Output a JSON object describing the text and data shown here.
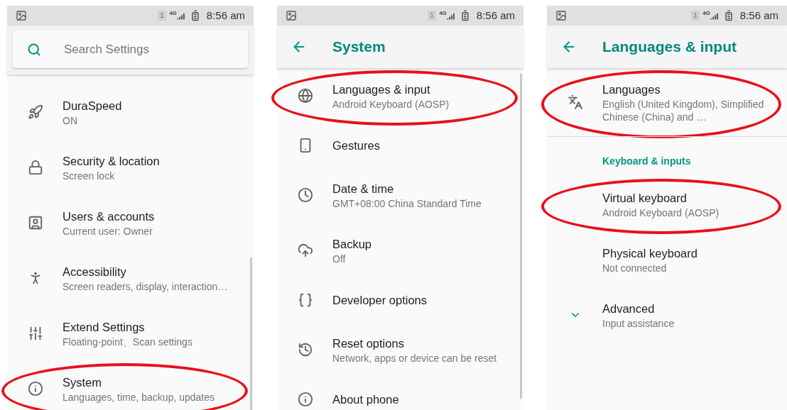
{
  "screens": [
    {
      "status_bar": {
        "sim": "1",
        "network": "4G",
        "time": "8:56 am"
      },
      "header": {
        "kind": "search",
        "placeholder": "Search Settings"
      },
      "items": [
        {
          "kind": "entry",
          "title": "DuraSpeed",
          "summary": "ON",
          "highlighted": false
        },
        {
          "kind": "entry",
          "title": "Security & location",
          "summary": "Screen lock",
          "highlighted": false
        },
        {
          "kind": "entry",
          "title": "Users & accounts",
          "summary": "Current user: Owner",
          "highlighted": false
        },
        {
          "kind": "entry",
          "title": "Accessibility",
          "summary": "Screen readers, display, interaction…",
          "highlighted": false
        },
        {
          "kind": "entry",
          "title": "Extend Settings",
          "summary": "Floating-point、Scan settings",
          "highlighted": false
        },
        {
          "kind": "entry",
          "title": "System",
          "summary": "Languages, time, backup, updates",
          "highlighted": true
        }
      ]
    },
    {
      "status_bar": {
        "sim": "1",
        "network": "4G",
        "time": "8:56 am"
      },
      "header": {
        "kind": "toolbar",
        "title": "System"
      },
      "items": [
        {
          "kind": "entry",
          "title": "Languages & input",
          "summary": "Android Keyboard (AOSP)",
          "highlighted": true
        },
        {
          "kind": "entry",
          "title": "Gestures",
          "highlighted": false
        },
        {
          "kind": "entry",
          "title": "Date & time",
          "summary": "GMT+08:00 China Standard Time",
          "highlighted": false
        },
        {
          "kind": "entry",
          "title": "Backup",
          "summary": "Off",
          "highlighted": false
        },
        {
          "kind": "entry",
          "title": "Developer options",
          "highlighted": false
        },
        {
          "kind": "entry",
          "title": "Reset options",
          "summary": "Network, apps or device can be reset",
          "highlighted": false
        },
        {
          "kind": "entry",
          "title": "About phone",
          "highlighted": false
        }
      ]
    },
    {
      "status_bar": {
        "sim": "1",
        "network": "4G",
        "time": "8:56 am"
      },
      "header": {
        "kind": "toolbar",
        "title": "Languages & input"
      },
      "items": [
        {
          "kind": "entry",
          "title": "Languages",
          "summary": "English (United Kingdom), Simplified Chinese (China) and …",
          "highlighted": true
        },
        {
          "kind": "category",
          "title": "Keyboard & inputs"
        },
        {
          "kind": "entry",
          "title": "Virtual keyboard",
          "summary": "Android Keyboard (AOSP)",
          "highlighted": true
        },
        {
          "kind": "entry",
          "title": "Physical keyboard",
          "summary": "Not connected",
          "highlighted": false
        },
        {
          "kind": "entry",
          "title": "Advanced",
          "summary": "Input assistance",
          "highlighted": false
        }
      ]
    }
  ]
}
